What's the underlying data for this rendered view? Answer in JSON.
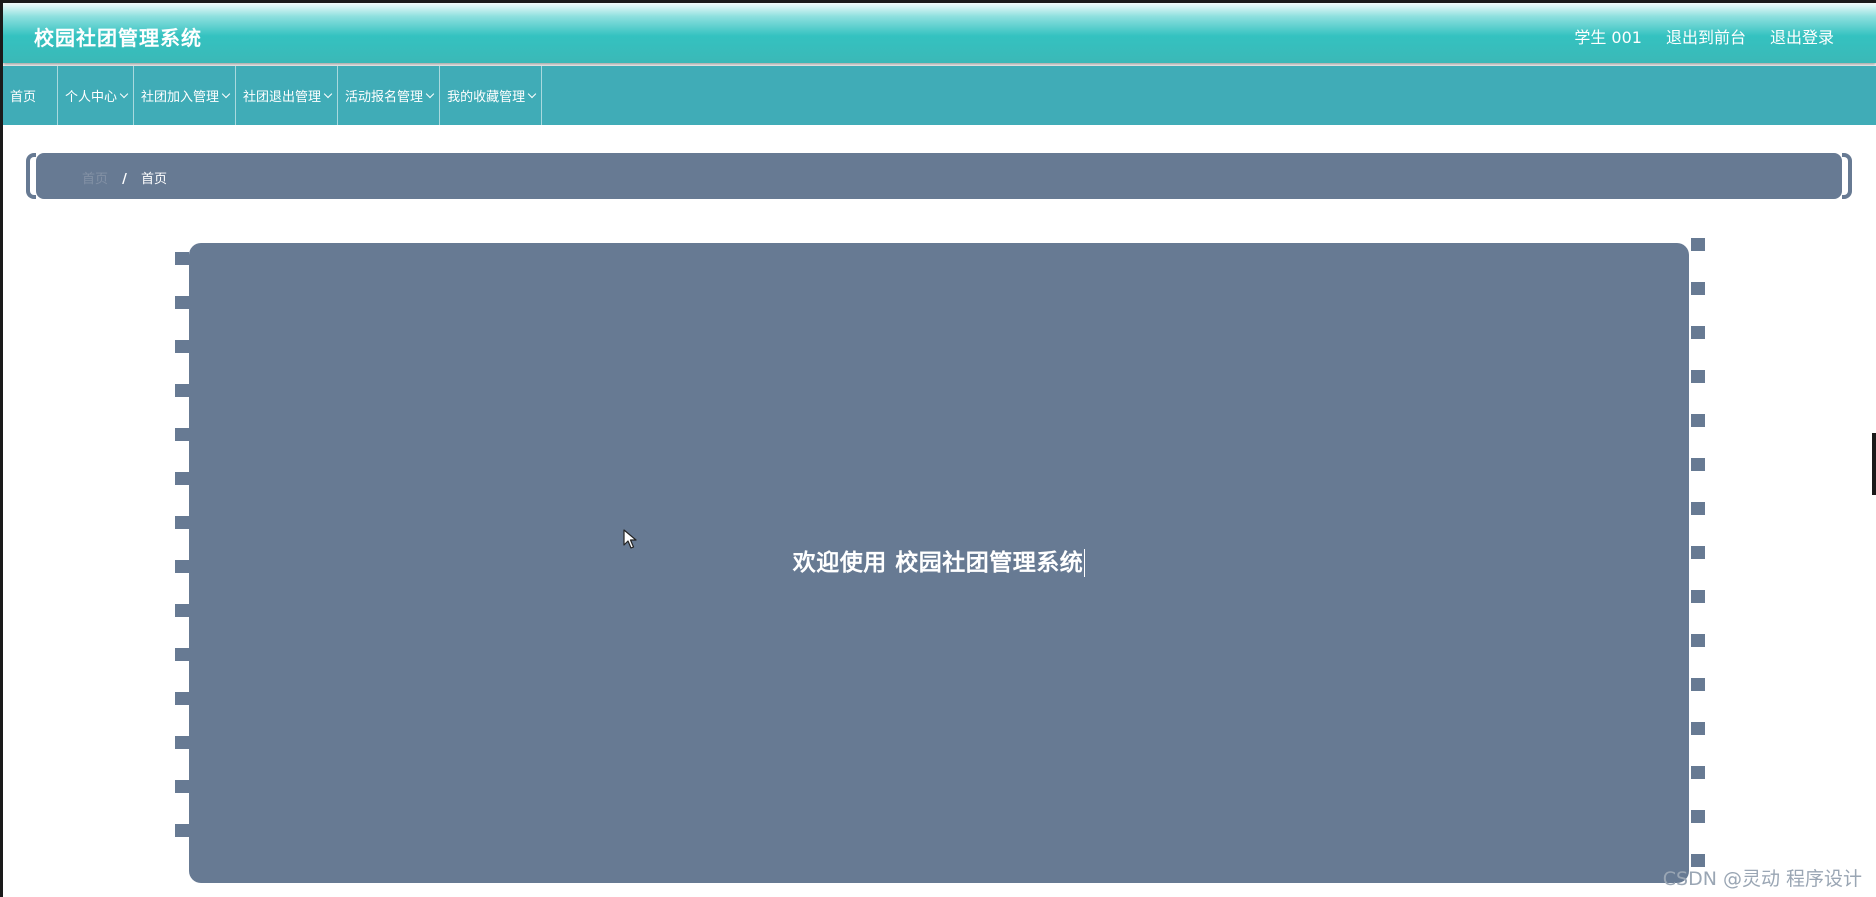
{
  "header": {
    "title": "校园社团管理系统",
    "links": [
      "学生 001",
      "退出到前台",
      "退出登录"
    ]
  },
  "nav": {
    "items": [
      {
        "label": "首页",
        "dropdown": false
      },
      {
        "label": "个人中心",
        "dropdown": true
      },
      {
        "label": "社团加入管理",
        "dropdown": true
      },
      {
        "label": "社团退出管理",
        "dropdown": true
      },
      {
        "label": "活动报名管理",
        "dropdown": true
      },
      {
        "label": "我的收藏管理",
        "dropdown": true
      }
    ]
  },
  "breadcrumb": {
    "home": "首页",
    "separator": "/",
    "current": "首页"
  },
  "main": {
    "welcome": "欢迎使用 校园社团管理系统"
  },
  "watermark": "CSDN @灵动 程序设计",
  "colors": {
    "header_teal": "#3bb8b7",
    "nav_teal": "#40acb7",
    "panel_slate": "#677a93"
  }
}
